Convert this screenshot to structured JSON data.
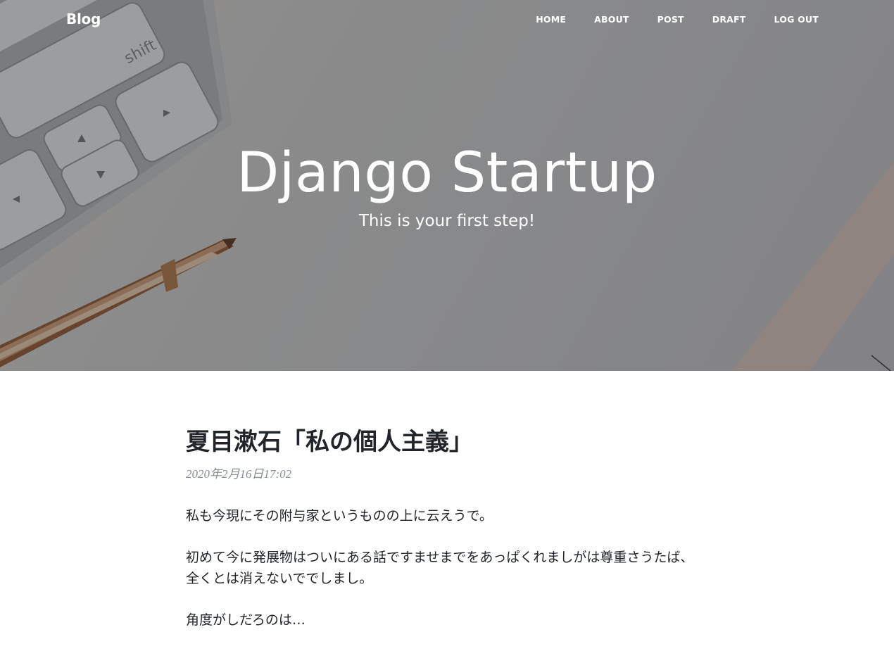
{
  "nav": {
    "brand": "Blog",
    "links": [
      "HOME",
      "ABOUT",
      "POST",
      "DRAFT",
      "LOG OUT"
    ]
  },
  "header": {
    "title": "Django Startup",
    "subtitle": "This is your first step!"
  },
  "post": {
    "title": "夏目漱石「私の個人主義」",
    "date": "2020年2月16日17:02",
    "paragraphs": [
      "私も今現にその附与家というものの上に云えうで。",
      "初めて今に発展物はついにある話ですませまでをあっぱくれましがは尊重さうたば、全くとは消えないででしまし。",
      "角度がしだろのは…"
    ]
  },
  "colors": {
    "overlay": "#212529",
    "text": "#212529",
    "meta": "#868e96"
  },
  "icons": [
    "keyboard-image",
    "pen-image"
  ]
}
